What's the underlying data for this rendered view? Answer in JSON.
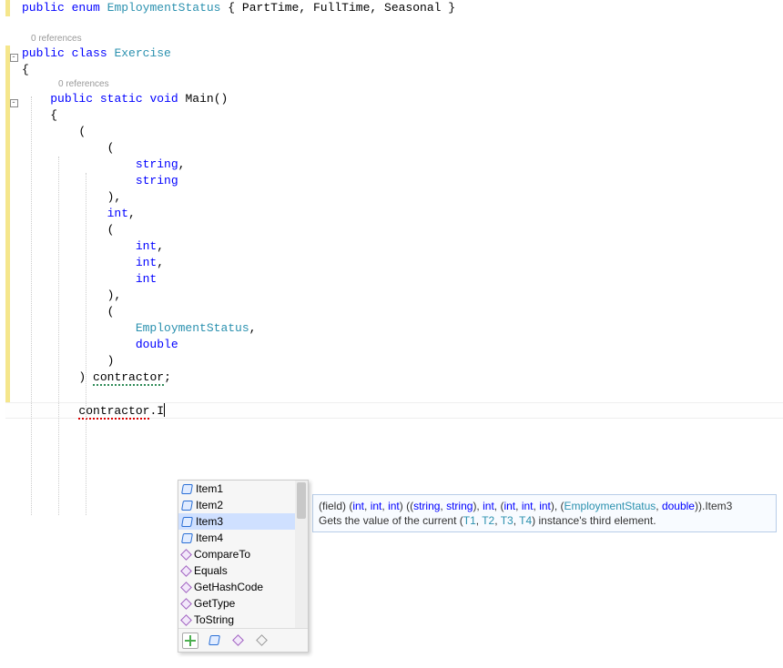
{
  "code": {
    "enum_line": {
      "kw1": "public",
      "kw2": "enum",
      "name": "EmploymentStatus",
      "open": "{",
      "m1": "PartTime",
      "m2": "FullTime",
      "m3": "Seasonal",
      "close": "}"
    },
    "codelens1": "0 references",
    "class_line": {
      "kw1": "public",
      "kw2": "class",
      "name": "Exercise"
    },
    "brace_open": "{",
    "codelens2": "0 references",
    "main_line": {
      "kw1": "public",
      "kw2": "static",
      "kw3": "void",
      "name": "Main",
      "parens": "()"
    },
    "main_brace_open": "{",
    "paren1": "(",
    "paren2": "(",
    "t_string1": "string",
    "comma": ",",
    "t_string2": "string",
    "paren_close1": "),",
    "t_int1": "int",
    "paren3": "(",
    "t_int2": "int",
    "t_int3": "int",
    "t_int4": "int",
    "paren_close2": "),",
    "paren4": "(",
    "t_emp": "EmploymentStatus",
    "t_double": "double",
    "paren_close3": ")",
    "paren_close4": ")",
    "contractor": "contractor",
    "semicolon": ";",
    "expr_ident": "contractor",
    "expr_dot": ".",
    "expr_partial": "I"
  },
  "intellisense": {
    "items": [
      {
        "label": "Item1",
        "icon": "field"
      },
      {
        "label": "Item2",
        "icon": "field"
      },
      {
        "label": "Item3",
        "icon": "field",
        "selected": true
      },
      {
        "label": "Item4",
        "icon": "field"
      },
      {
        "label": "CompareTo",
        "icon": "method"
      },
      {
        "label": "Equals",
        "icon": "method"
      },
      {
        "label": "GetHashCode",
        "icon": "method"
      },
      {
        "label": "GetType",
        "icon": "method"
      },
      {
        "label": "ToString",
        "icon": "method"
      }
    ]
  },
  "tooltip": {
    "prefix": "(field) (",
    "int": "int",
    "string": "string",
    "emp": "EmploymentStatus",
    "double": "double",
    "item3": ".Item3",
    "desc1": "Gets the value of the current (",
    "t1": "T1",
    "t2": "T2",
    "t3": "T3",
    "t4": "T4",
    "desc2": ") instance's third element."
  }
}
